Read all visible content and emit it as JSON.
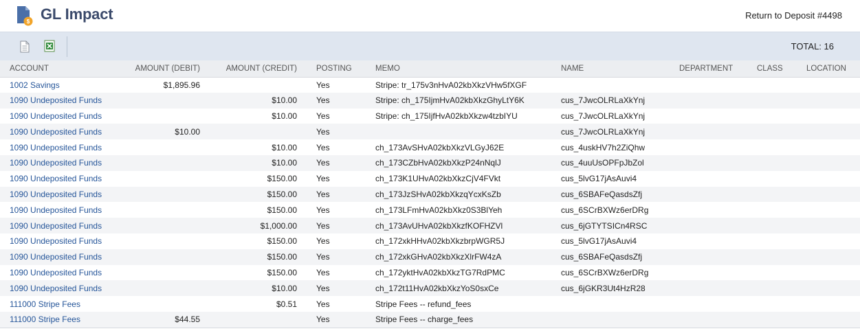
{
  "header": {
    "title": "GL Impact",
    "return_link": "Return to Deposit #4498"
  },
  "toolbar": {
    "icons": [
      "document-icon",
      "excel-export-icon"
    ],
    "total": "TOTAL: 16"
  },
  "table": {
    "columns": [
      "ACCOUNT",
      "AMOUNT (DEBIT)",
      "AMOUNT (CREDIT)",
      "POSTING",
      "MEMO",
      "NAME",
      "DEPARTMENT",
      "CLASS",
      "LOCATION"
    ],
    "rows": [
      {
        "account": "1002 Savings",
        "debit": "$1,895.96",
        "credit": "",
        "posting": "Yes",
        "memo": "Stripe: tr_175v3nHvA02kbXkzVHw5fXGF",
        "name": "",
        "department": "",
        "class": "",
        "location": ""
      },
      {
        "account": "1090 Undeposited Funds",
        "debit": "",
        "credit": "$10.00",
        "posting": "Yes",
        "memo": "Stripe: ch_175IjmHvA02kbXkzGhyLtY6K",
        "name": "cus_7JwcOLRLaXkYnj",
        "department": "",
        "class": "",
        "location": ""
      },
      {
        "account": "1090 Undeposited Funds",
        "debit": "",
        "credit": "$10.00",
        "posting": "Yes",
        "memo": "Stripe: ch_175IjfHvA02kbXkzw4tzbIYU",
        "name": "cus_7JwcOLRLaXkYnj",
        "department": "",
        "class": "",
        "location": ""
      },
      {
        "account": "1090 Undeposited Funds",
        "debit": "$10.00",
        "credit": "",
        "posting": "Yes",
        "memo": "",
        "name": "cus_7JwcOLRLaXkYnj",
        "department": "",
        "class": "",
        "location": ""
      },
      {
        "account": "1090 Undeposited Funds",
        "debit": "",
        "credit": "$10.00",
        "posting": "Yes",
        "memo": "ch_173AvSHvA02kbXkzVLGyJ62E",
        "name": "cus_4uskHV7h2ZiQhw",
        "department": "",
        "class": "",
        "location": ""
      },
      {
        "account": "1090 Undeposited Funds",
        "debit": "",
        "credit": "$10.00",
        "posting": "Yes",
        "memo": "ch_173CZbHvA02kbXkzP24nNqlJ",
        "name": "cus_4uuUsOPFpJbZol",
        "department": "",
        "class": "",
        "location": ""
      },
      {
        "account": "1090 Undeposited Funds",
        "debit": "",
        "credit": "$150.00",
        "posting": "Yes",
        "memo": "ch_173K1UHvA02kbXkzCjV4FVkt",
        "name": "cus_5lvG17jAsAuvi4",
        "department": "",
        "class": "",
        "location": ""
      },
      {
        "account": "1090 Undeposited Funds",
        "debit": "",
        "credit": "$150.00",
        "posting": "Yes",
        "memo": "ch_173JzSHvA02kbXkzqYcxKsZb",
        "name": "cus_6SBAFeQasdsZfj",
        "department": "",
        "class": "",
        "location": ""
      },
      {
        "account": "1090 Undeposited Funds",
        "debit": "",
        "credit": "$150.00",
        "posting": "Yes",
        "memo": "ch_173LFmHvA02kbXkz0S3BlYeh",
        "name": "cus_6SCrBXWz6erDRg",
        "department": "",
        "class": "",
        "location": ""
      },
      {
        "account": "1090 Undeposited Funds",
        "debit": "",
        "credit": "$1,000.00",
        "posting": "Yes",
        "memo": "ch_173AvUHvA02kbXkzfKOFHZVl",
        "name": "cus_6jGTYTSICn4RSC",
        "department": "",
        "class": "",
        "location": ""
      },
      {
        "account": "1090 Undeposited Funds",
        "debit": "",
        "credit": "$150.00",
        "posting": "Yes",
        "memo": "ch_172xkHHvA02kbXkzbrpWGR5J",
        "name": "cus_5lvG17jAsAuvi4",
        "department": "",
        "class": "",
        "location": ""
      },
      {
        "account": "1090 Undeposited Funds",
        "debit": "",
        "credit": "$150.00",
        "posting": "Yes",
        "memo": "ch_172xkGHvA02kbXkzXlrFW4zA",
        "name": "cus_6SBAFeQasdsZfj",
        "department": "",
        "class": "",
        "location": ""
      },
      {
        "account": "1090 Undeposited Funds",
        "debit": "",
        "credit": "$150.00",
        "posting": "Yes",
        "memo": "ch_172yktHvA02kbXkzTG7RdPMC",
        "name": "cus_6SCrBXWz6erDRg",
        "department": "",
        "class": "",
        "location": ""
      },
      {
        "account": "1090 Undeposited Funds",
        "debit": "",
        "credit": "$10.00",
        "posting": "Yes",
        "memo": "ch_172t11HvA02kbXkzYoS0sxCe",
        "name": "cus_6jGKR3Ut4HzR28",
        "department": "",
        "class": "",
        "location": ""
      },
      {
        "account": "111000 Stripe Fees",
        "debit": "",
        "credit": "$0.51",
        "posting": "Yes",
        "memo": "Stripe Fees -- refund_fees",
        "name": "",
        "department": "",
        "class": "",
        "location": ""
      },
      {
        "account": "111000 Stripe Fees",
        "debit": "$44.55",
        "credit": "",
        "posting": "Yes",
        "memo": "Stripe Fees -- charge_fees",
        "name": "",
        "department": "",
        "class": "",
        "location": ""
      }
    ]
  },
  "colors": {
    "title": "#3b4a6b",
    "link": "#255599",
    "toolbar_bg": "#dfe6f0",
    "header_row_bg": "#eceef1",
    "stripe_row_bg": "#f3f4f6"
  }
}
